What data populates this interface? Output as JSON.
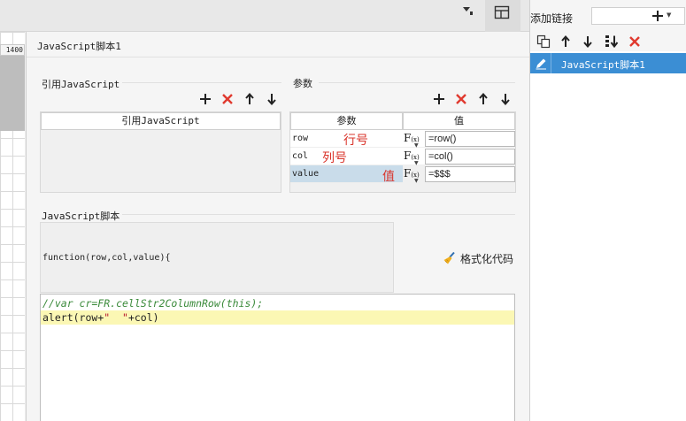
{
  "ruler": {
    "value": "1400"
  },
  "dialog": {
    "title": "JavaScript脚本1"
  },
  "imports": {
    "section_title": "引用JavaScript",
    "column_header": "引用JavaScript"
  },
  "params": {
    "section_title": "参数",
    "column_param": "参数",
    "column_value": "值",
    "rows": [
      {
        "name": "row",
        "note": "行号",
        "fx_label": "F",
        "fx_sub": "(x)",
        "value": "=row()"
      },
      {
        "name": "col",
        "note": "列号",
        "fx_label": "F",
        "fx_sub": "(x)",
        "value": "=col()"
      },
      {
        "name": "value",
        "note": "值",
        "fx_label": "F",
        "fx_sub": "(x)",
        "value": "=$$$"
      }
    ]
  },
  "script": {
    "section_title": "JavaScript脚本",
    "signature": "function(row,col,value){",
    "format_label": "格式化代码",
    "code": {
      "line1": "//var cr=FR.cellStr2ColumnRow(this);",
      "line2_prefix": "alert(",
      "line2_a": "row+",
      "line2_str": "\"  \"",
      "line2_b": "+col)"
    }
  },
  "links_panel": {
    "title": "添加链接",
    "items": [
      {
        "label": "JavaScript脚本1",
        "selected": true
      }
    ]
  },
  "colors": {
    "accent": "#3b8ed4",
    "delete": "#e03a2f",
    "note": "#d9342b",
    "highlight_line": "#fbf7b4",
    "comment": "#3a8a3a"
  }
}
